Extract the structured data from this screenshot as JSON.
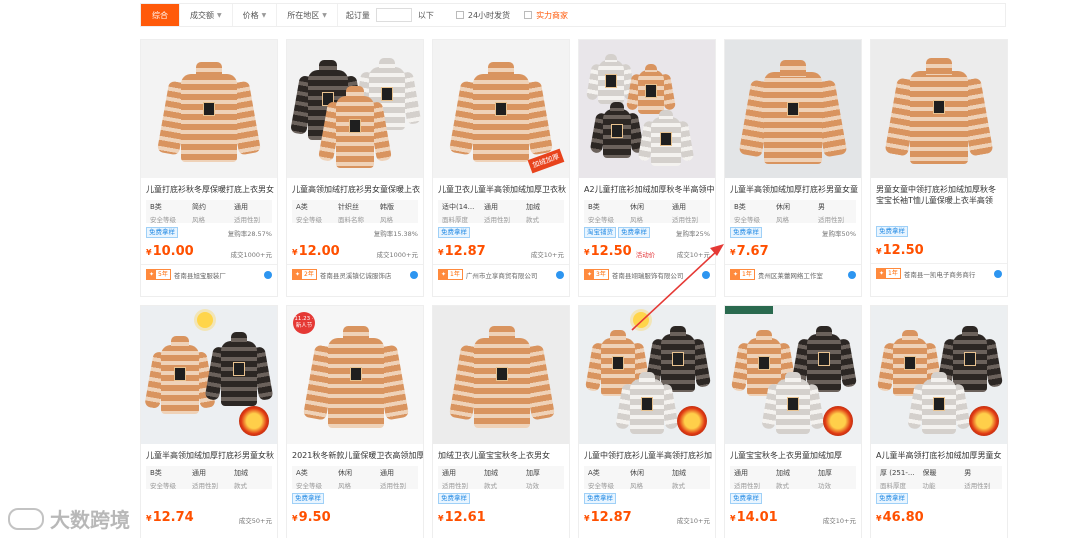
{
  "filter_bar": {
    "tabs": [
      "综合",
      "成交额",
      "价格",
      "所在地区"
    ],
    "moq_label": "起订量",
    "moq_suffix": "以下",
    "ship_24h": "24小时发货",
    "strong_merchant": "实力商家"
  },
  "products": [
    {
      "title": "儿童打底衫秋冬厚保暖打底上衣男女",
      "attrs": [
        {
          "v": "B类",
          "k": "安全等级"
        },
        {
          "v": "简约",
          "k": "风格"
        },
        {
          "v": "通用",
          "k": "适用性别"
        }
      ],
      "tags": [
        "免费拿样"
      ],
      "note": "复购率28.57%",
      "price": "10.00",
      "sales": "成交1000+元",
      "years": "5年",
      "shop": "苍南县旭宝服装厂"
    },
    {
      "title": "儿童高领加绒打底衫男女童保暖上衣",
      "attrs": [
        {
          "v": "A类",
          "k": "安全等级"
        },
        {
          "v": "针织丝",
          "k": "面料名称"
        },
        {
          "v": "韩版",
          "k": "风格"
        }
      ],
      "tags": [],
      "note": "复购率15.38%",
      "price": "12.00",
      "sales": "成交1000+元",
      "years": "2年",
      "shop": "苍南县灵溪镇亿诚服饰店"
    },
    {
      "title": "儿童卫衣儿童半高领加绒加厚卫衣秋",
      "attrs": [
        {
          "v": "适中(14...",
          "k": "面料厚度"
        },
        {
          "v": "通用",
          "k": "适用性别"
        },
        {
          "v": "加绒",
          "k": "款式"
        }
      ],
      "tags": [
        "免费拿样"
      ],
      "note": "",
      "price": "12.87",
      "sales": "成交10+元",
      "years": "1年",
      "shop": "广州市立享商贸有限公司"
    },
    {
      "title": "A2儿童打底衫加绒加厚秋冬半高领中",
      "attrs": [
        {
          "v": "B类",
          "k": "安全等级"
        },
        {
          "v": "休闲",
          "k": "风格"
        },
        {
          "v": "通用",
          "k": "适用性别"
        }
      ],
      "tags": [
        "淘宝铺货",
        "免费拿样"
      ],
      "note": "复购率25%",
      "price": "12.50",
      "promo": "活动价",
      "sales": "成交10+元",
      "years": "3年",
      "shop": "苍南县翊瑞服饰有限公司"
    },
    {
      "title": "儿童半高领加绒加厚打底衫男童女童",
      "attrs": [
        {
          "v": "B类",
          "k": "安全等级"
        },
        {
          "v": "休闲",
          "k": "风格"
        },
        {
          "v": "男",
          "k": "适用性别"
        }
      ],
      "tags": [
        "免费拿样"
      ],
      "note": "复购率50%",
      "price": "7.67",
      "sales": "",
      "years": "1年",
      "shop": "贵州区莱蕾网络工作室"
    },
    {
      "title": "男童女童中领打底衫加绒加厚秋冬宝宝长袖T恤儿童保暖上衣半高领",
      "attrs": [],
      "tags": [
        "免费拿样"
      ],
      "note": "",
      "price": "12.50",
      "sales": "",
      "years": "1年",
      "shop": "苍南县一凯电子商务商行"
    },
    {
      "title": "儿童半高领加绒加厚打底衫男童女秋",
      "attrs": [
        {
          "v": "B类",
          "k": "安全等级"
        },
        {
          "v": "通用",
          "k": "适用性别"
        },
        {
          "v": "加绒",
          "k": "款式"
        }
      ],
      "tags": [],
      "note": "",
      "price": "12.74",
      "sales": "成交50+元",
      "years": "",
      "shop": ""
    },
    {
      "title": "2021秋冬新款儿童保暖卫衣高领加厚",
      "attrs": [
        {
          "v": "A类",
          "k": "安全等级"
        },
        {
          "v": "休闲",
          "k": "风格"
        },
        {
          "v": "通用",
          "k": "适用性别"
        }
      ],
      "tags": [
        "免费拿样"
      ],
      "note": "",
      "price": "9.50",
      "sales": "",
      "years": "",
      "shop": ""
    },
    {
      "title": "加绒卫衣儿童宝宝秋冬上衣男女",
      "attrs": [
        {
          "v": "通用",
          "k": "适用性别"
        },
        {
          "v": "加绒",
          "k": "款式"
        },
        {
          "v": "加厚",
          "k": "功效"
        }
      ],
      "tags": [
        "免费拿样"
      ],
      "note": "",
      "price": "12.61",
      "sales": "",
      "years": "",
      "shop": ""
    },
    {
      "title": "儿童中领打底衫儿童半高领打底衫加",
      "attrs": [
        {
          "v": "A类",
          "k": "安全等级"
        },
        {
          "v": "休闲",
          "k": "风格"
        },
        {
          "v": "加绒",
          "k": "款式"
        }
      ],
      "tags": [
        "免费拿样"
      ],
      "note": "",
      "price": "12.87",
      "sales": "成交10+元",
      "years": "",
      "shop": ""
    },
    {
      "title": "儿童宝宝秋冬上衣男童加绒加厚",
      "attrs": [
        {
          "v": "通用",
          "k": "适用性别"
        },
        {
          "v": "加绒",
          "k": "款式"
        },
        {
          "v": "加厚",
          "k": "功效"
        }
      ],
      "tags": [
        "免费拿样"
      ],
      "note": "",
      "price": "14.01",
      "sales": "成交10+元",
      "years": "",
      "shop": ""
    },
    {
      "title": "A儿童半高领打底衫加绒加厚男童女",
      "attrs": [
        {
          "v": "厚 (251-...",
          "k": "面料厚度"
        },
        {
          "v": "保暖",
          "k": "功能"
        },
        {
          "v": "男",
          "k": "适用性别"
        }
      ],
      "tags": [
        "免费拿样"
      ],
      "note": "",
      "price": "46.80",
      "sales": "",
      "years": "",
      "shop": ""
    }
  ],
  "image_badges": {
    "new_badge": "11.23 ·新人节",
    "promo_ribbon": "加绒加厚"
  },
  "watermark": "大数跨境",
  "colors": {
    "accent": "#ff5a0a",
    "price": "#ff5000",
    "arrow": "#e53935"
  }
}
